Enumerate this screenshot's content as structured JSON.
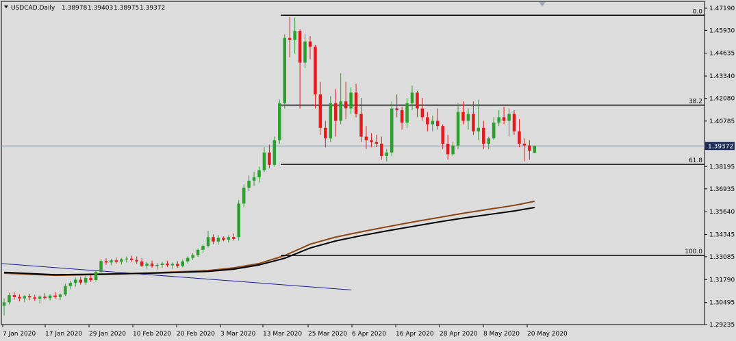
{
  "header": {
    "symbol": "USDCAD,Daily",
    "open": "1.38978",
    "high": "1.39403",
    "low": "1.38975",
    "close": "1.39372"
  },
  "chart_data": {
    "type": "candlestick",
    "ylim": [
      1.29235,
      1.4719
    ],
    "y_ticks": [
      "1.47190",
      "1.45930",
      "1.44635",
      "1.43340",
      "1.42080",
      "1.40785",
      "1.39372",
      "1.38195",
      "1.36935",
      "1.35640",
      "1.34345",
      "1.33085",
      "1.31790",
      "1.30495",
      "1.29235"
    ],
    "x_labels": [
      "7 Jan 2020",
      "17 Jan 2020",
      "29 Jan 2020",
      "10 Feb 2020",
      "20 Feb 2020",
      "3 Mar 2020",
      "13 Mar 2020",
      "25 Mar 2020",
      "6 Apr 2020",
      "16 Apr 2020",
      "28 Apr 2020",
      "8 May 2020",
      "20 May 2020"
    ],
    "current_price": "1.39372",
    "fibonacci": {
      "levels": [
        {
          "label": "0.0",
          "price": 1.4679
        },
        {
          "label": "38.2",
          "price": 1.4169
        },
        {
          "label": "61.8",
          "price": 1.3833
        },
        {
          "label": "100.0",
          "price": 1.3316
        }
      ]
    },
    "colors": {
      "background": "#dcdcdc",
      "bull": "#2ca02c",
      "bear": "#e31a1c",
      "ma_fast": "#8b4513",
      "ma_slow": "#000000",
      "trendline": "#1a1aa0",
      "bid_line": "#8a9bb0"
    },
    "candles": [
      [
        1.303,
        1.3072,
        1.2975,
        1.305
      ],
      [
        1.305,
        1.3105,
        1.3038,
        1.309
      ],
      [
        1.309,
        1.3108,
        1.3065,
        1.308
      ],
      [
        1.308,
        1.3095,
        1.3055,
        1.3072
      ],
      [
        1.3072,
        1.309,
        1.305,
        1.3085
      ],
      [
        1.3085,
        1.3098,
        1.3062,
        1.3078
      ],
      [
        1.3078,
        1.3092,
        1.3058,
        1.307
      ],
      [
        1.307,
        1.3088,
        1.3042,
        1.3082
      ],
      [
        1.3082,
        1.3102,
        1.3066,
        1.3074
      ],
      [
        1.3074,
        1.3096,
        1.306,
        1.3088
      ],
      [
        1.3088,
        1.3108,
        1.307,
        1.308
      ],
      [
        1.308,
        1.31,
        1.3062,
        1.3094
      ],
      [
        1.3094,
        1.3155,
        1.3086,
        1.3142
      ],
      [
        1.3142,
        1.3172,
        1.3124,
        1.316
      ],
      [
        1.316,
        1.319,
        1.314,
        1.3178
      ],
      [
        1.3178,
        1.3195,
        1.315,
        1.3162
      ],
      [
        1.3162,
        1.32,
        1.315,
        1.3188
      ],
      [
        1.3188,
        1.3206,
        1.3166,
        1.3176
      ],
      [
        1.3176,
        1.323,
        1.3168,
        1.3222
      ],
      [
        1.3222,
        1.3295,
        1.3212,
        1.3284
      ],
      [
        1.3284,
        1.33,
        1.3262,
        1.3276
      ],
      [
        1.3276,
        1.3296,
        1.326,
        1.3288
      ],
      [
        1.3288,
        1.3304,
        1.327,
        1.328
      ],
      [
        1.328,
        1.3302,
        1.3264,
        1.3294
      ],
      [
        1.3294,
        1.331,
        1.3276,
        1.3298
      ],
      [
        1.3298,
        1.3314,
        1.328,
        1.329
      ],
      [
        1.329,
        1.331,
        1.3268,
        1.3282
      ],
      [
        1.3282,
        1.33,
        1.325,
        1.3258
      ],
      [
        1.3258,
        1.328,
        1.324,
        1.327
      ],
      [
        1.327,
        1.3286,
        1.3246,
        1.3256
      ],
      [
        1.3256,
        1.3274,
        1.3236,
        1.3262
      ],
      [
        1.3262,
        1.328,
        1.3246,
        1.327
      ],
      [
        1.327,
        1.3286,
        1.325,
        1.326
      ],
      [
        1.326,
        1.3276,
        1.324,
        1.3268
      ],
      [
        1.3268,
        1.3284,
        1.3246,
        1.3256
      ],
      [
        1.3256,
        1.3292,
        1.3248,
        1.3282
      ],
      [
        1.3282,
        1.3312,
        1.327,
        1.3302
      ],
      [
        1.3302,
        1.333,
        1.329,
        1.3318
      ],
      [
        1.3318,
        1.3356,
        1.3308,
        1.3348
      ],
      [
        1.3348,
        1.338,
        1.333,
        1.337
      ],
      [
        1.337,
        1.3455,
        1.336,
        1.342
      ],
      [
        1.342,
        1.3436,
        1.338,
        1.3395
      ],
      [
        1.3395,
        1.3432,
        1.3376,
        1.3416
      ],
      [
        1.3416,
        1.3424,
        1.3396,
        1.3405
      ],
      [
        1.3405,
        1.343,
        1.339,
        1.342
      ],
      [
        1.342,
        1.344,
        1.34,
        1.341
      ],
      [
        1.342,
        1.363,
        1.34,
        1.361
      ],
      [
        1.361,
        1.372,
        1.359,
        1.37
      ],
      [
        1.37,
        1.377,
        1.368,
        1.374
      ],
      [
        1.374,
        1.379,
        1.371,
        1.376
      ],
      [
        1.376,
        1.382,
        1.373,
        1.38
      ],
      [
        1.38,
        1.393,
        1.379,
        1.39
      ],
      [
        1.39,
        1.3945,
        1.381,
        1.383
      ],
      [
        1.383,
        1.399,
        1.382,
        1.397
      ],
      [
        1.397,
        1.42,
        1.395,
        1.418
      ],
      [
        1.418,
        1.457,
        1.415,
        1.455
      ],
      [
        1.455,
        1.467,
        1.444,
        1.454
      ],
      [
        1.454,
        1.4666,
        1.446,
        1.459
      ],
      [
        1.459,
        1.46,
        1.415,
        1.441
      ],
      [
        1.441,
        1.457,
        1.438,
        1.453
      ],
      [
        1.453,
        1.456,
        1.443,
        1.45
      ],
      [
        1.45,
        1.451,
        1.415,
        1.423
      ],
      [
        1.423,
        1.43,
        1.4,
        1.404
      ],
      [
        1.404,
        1.408,
        1.393,
        1.398
      ],
      [
        1.398,
        1.422,
        1.396,
        1.418
      ],
      [
        1.418,
        1.426,
        1.399,
        1.408
      ],
      [
        1.408,
        1.435,
        1.406,
        1.419
      ],
      [
        1.419,
        1.43,
        1.409,
        1.415
      ],
      [
        1.415,
        1.427,
        1.412,
        1.424
      ],
      [
        1.424,
        1.429,
        1.41,
        1.412
      ],
      [
        1.412,
        1.421,
        1.396,
        1.399
      ],
      [
        1.399,
        1.405,
        1.392,
        1.397
      ],
      [
        1.397,
        1.401,
        1.393,
        1.396
      ],
      [
        1.396,
        1.4,
        1.393,
        1.395
      ],
      [
        1.395,
        1.399,
        1.386,
        1.388
      ],
      [
        1.388,
        1.392,
        1.385,
        1.39
      ],
      [
        1.39,
        1.419,
        1.388,
        1.415
      ],
      [
        1.415,
        1.423,
        1.41,
        1.414
      ],
      [
        1.414,
        1.416,
        1.403,
        1.407
      ],
      [
        1.407,
        1.421,
        1.404,
        1.418
      ],
      [
        1.418,
        1.428,
        1.414,
        1.424
      ],
      [
        1.424,
        1.425,
        1.41,
        1.415
      ],
      [
        1.415,
        1.421,
        1.408,
        1.41
      ],
      [
        1.41,
        1.413,
        1.402,
        1.406
      ],
      [
        1.406,
        1.411,
        1.402,
        1.408
      ],
      [
        1.408,
        1.415,
        1.403,
        1.405
      ],
      [
        1.405,
        1.406,
        1.392,
        1.395
      ],
      [
        1.395,
        1.4,
        1.386,
        1.389
      ],
      [
        1.389,
        1.396,
        1.388,
        1.394
      ],
      [
        1.394,
        1.418,
        1.392,
        1.413
      ],
      [
        1.413,
        1.419,
        1.406,
        1.408
      ],
      [
        1.408,
        1.415,
        1.403,
        1.412
      ],
      [
        1.412,
        1.419,
        1.4,
        1.402
      ],
      [
        1.402,
        1.42,
        1.397,
        1.404
      ],
      [
        1.404,
        1.408,
        1.392,
        1.395
      ],
      [
        1.395,
        1.399,
        1.392,
        1.398
      ],
      [
        1.398,
        1.41,
        1.397,
        1.407
      ],
      [
        1.407,
        1.414,
        1.405,
        1.41
      ],
      [
        1.41,
        1.416,
        1.406,
        1.408
      ],
      [
        1.408,
        1.415,
        1.399,
        1.412
      ],
      [
        1.412,
        1.414,
        1.4,
        1.402
      ],
      [
        1.402,
        1.409,
        1.393,
        1.395
      ],
      [
        1.395,
        1.398,
        1.385,
        1.394
      ],
      [
        1.394,
        1.397,
        1.386,
        1.391
      ],
      [
        1.3898,
        1.394,
        1.3898,
        1.3937
      ]
    ],
    "ma_fast": [
      [
        0,
        1.3215
      ],
      [
        10,
        1.3203
      ],
      [
        20,
        1.3208
      ],
      [
        30,
        1.3218
      ],
      [
        40,
        1.323
      ],
      [
        45,
        1.3245
      ],
      [
        50,
        1.327
      ],
      [
        55,
        1.3315
      ],
      [
        60,
        1.338
      ],
      [
        65,
        1.342
      ],
      [
        70,
        1.345
      ],
      [
        75,
        1.3478
      ],
      [
        80,
        1.3505
      ],
      [
        85,
        1.353
      ],
      [
        90,
        1.3555
      ],
      [
        95,
        1.3578
      ],
      [
        100,
        1.36
      ],
      [
        104,
        1.3623
      ]
    ],
    "ma_slow": [
      [
        0,
        1.322
      ],
      [
        10,
        1.3206
      ],
      [
        20,
        1.321
      ],
      [
        30,
        1.3216
      ],
      [
        40,
        1.3225
      ],
      [
        45,
        1.3238
      ],
      [
        50,
        1.3262
      ],
      [
        55,
        1.33
      ],
      [
        60,
        1.3358
      ],
      [
        65,
        1.3398
      ],
      [
        70,
        1.3428
      ],
      [
        75,
        1.3455
      ],
      [
        80,
        1.348
      ],
      [
        85,
        1.3505
      ],
      [
        90,
        1.3528
      ],
      [
        95,
        1.3548
      ],
      [
        100,
        1.3568
      ],
      [
        104,
        1.3588
      ]
    ],
    "trendline": [
      [
        0,
        1.327
      ],
      [
        63,
        1.312
      ]
    ]
  }
}
